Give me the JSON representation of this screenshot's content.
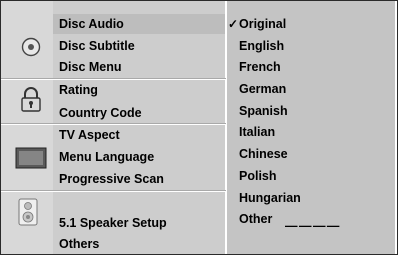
{
  "menu": {
    "items": [
      {
        "label": "Disc Audio"
      },
      {
        "label": "Disc Subtitle"
      },
      {
        "label": "Disc Menu"
      },
      {
        "label": "Rating"
      },
      {
        "label": "Country Code"
      },
      {
        "label": "TV Aspect"
      },
      {
        "label": "Menu Language"
      },
      {
        "label": "Progressive Scan"
      },
      {
        "label": "5.1 Speaker Setup"
      },
      {
        "label": "Others"
      }
    ],
    "selected": "Disc Audio"
  },
  "options": {
    "check_mark": "✓",
    "items": [
      {
        "label": "Original"
      },
      {
        "label": "English"
      },
      {
        "label": "French"
      },
      {
        "label": "German"
      },
      {
        "label": "Spanish"
      },
      {
        "label": "Italian"
      },
      {
        "label": "Chinese"
      },
      {
        "label": "Polish"
      },
      {
        "label": "Hungarian"
      },
      {
        "label": "Other"
      }
    ],
    "other_placeholder": "— — — —",
    "selected": "Original"
  },
  "icons": [
    "disc-icon",
    "lock-icon",
    "tv-icon",
    "speaker-icon"
  ],
  "colors": {
    "icon_column": "#d8d8d8",
    "menu_column": "#cdcdcd",
    "options_column": "#c4c4c4",
    "text": "#000000"
  }
}
